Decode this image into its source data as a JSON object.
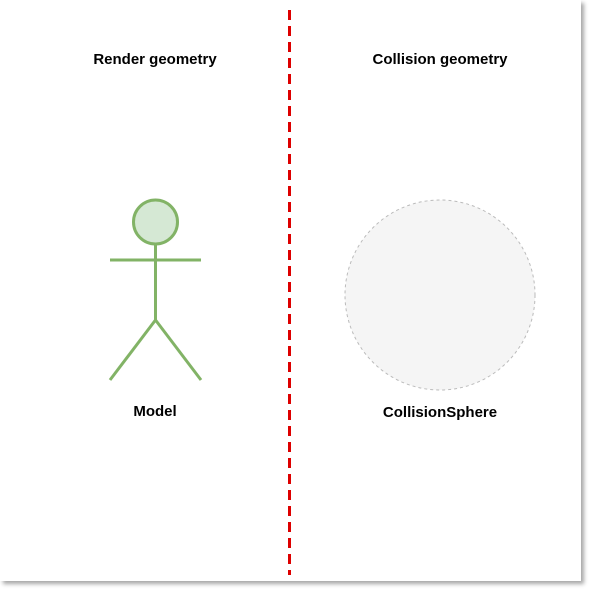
{
  "headings": {
    "left": "Render geometry",
    "right": "Collision geometry"
  },
  "nodes": {
    "model": {
      "label": "Model",
      "icon": "stick-figure-icon"
    },
    "collision_sphere": {
      "label": "CollisionSphere",
      "icon": "sphere-icon"
    }
  },
  "colors": {
    "divider": "#dd0000",
    "figure_stroke": "#82b366",
    "figure_fill": "#d5e8d4",
    "sphere_stroke": "#bbbbbb",
    "sphere_fill": "#f5f5f5"
  }
}
